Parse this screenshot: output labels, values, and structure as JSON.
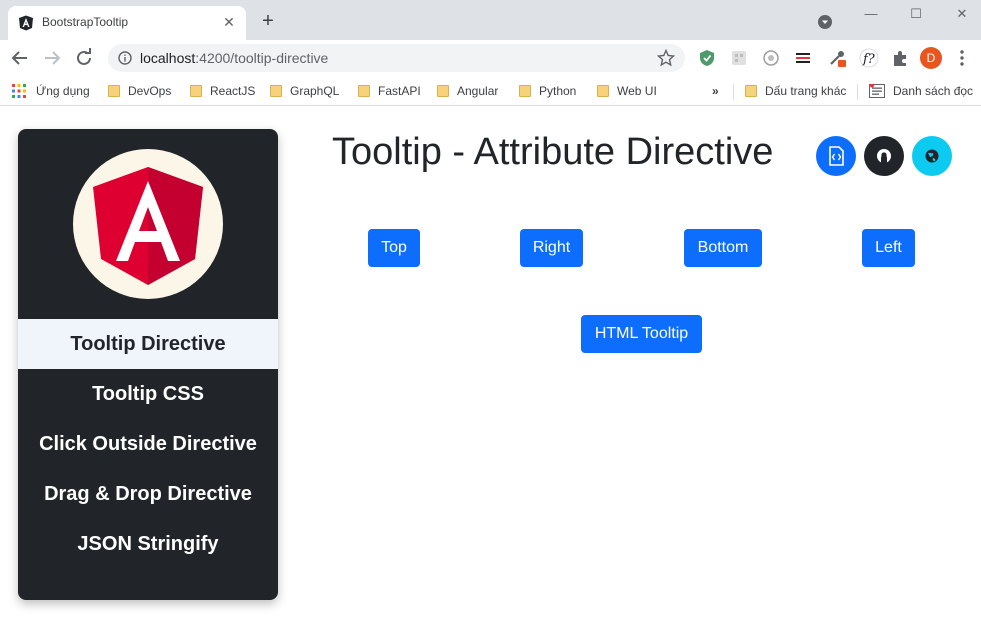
{
  "browser": {
    "tab_title": "BootstrapTooltip",
    "tab_close": "✕",
    "new_tab": "+",
    "url_host": "localhost",
    "url_path": ":4200/tooltip-directive",
    "avatar_letter": "D",
    "win_minimize": "—",
    "win_maximize": "☐",
    "win_close": "✕"
  },
  "bookmarks": {
    "apps": "Ứng dụng",
    "items": [
      "DevOps",
      "ReactJS",
      "GraphQL",
      "FastAPI",
      "Angular",
      "Python",
      "Web UI"
    ],
    "overflow": "»",
    "other": "Dấu trang khác",
    "reading_list": "Danh sách đọc"
  },
  "sidebar": {
    "items": [
      {
        "label": "Tooltip Directive",
        "active": true
      },
      {
        "label": "Tooltip CSS"
      },
      {
        "label": "Click Outside Directive"
      },
      {
        "label": "Drag & Drop Directive"
      },
      {
        "label": "JSON Stringify"
      }
    ]
  },
  "main": {
    "title": "Tooltip - Attribute Directive",
    "buttons": {
      "top": "Top",
      "right": "Right",
      "bottom": "Bottom",
      "left": "Left",
      "html": "HTML Tooltip"
    },
    "icon_buttons": [
      {
        "icon": "file-code-icon",
        "color": "#0d6efd"
      },
      {
        "icon": "github-icon",
        "color": "#212529"
      },
      {
        "icon": "globe-icon",
        "color": "#0dcaf0"
      }
    ]
  },
  "colors": {
    "primary": "#0d6efd",
    "dark": "#212529",
    "info": "#0dcaf0",
    "angular_red": "#dd0031"
  }
}
